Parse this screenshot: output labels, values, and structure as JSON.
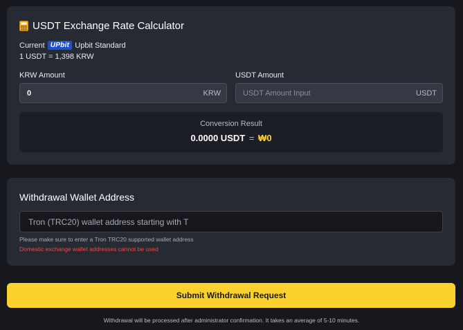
{
  "calculator": {
    "title": "USDT Exchange Rate Calculator",
    "icon": "calculator-icon",
    "rate_prefix": "Current",
    "exchange_logo": "UPbit",
    "rate_suffix": "Upbit Standard",
    "rate_value": "1 USDT = 1,398 KRW",
    "krw_label": "KRW Amount",
    "krw_value": "0",
    "krw_unit": "KRW",
    "usdt_label": "USDT Amount",
    "usdt_placeholder": "USDT Amount Input",
    "usdt_unit": "USDT",
    "result_label": "Conversion Result",
    "result_usdt": "0.0000 USDT",
    "result_eq": "=",
    "result_krw": "₩0"
  },
  "wallet": {
    "title": "Withdrawal Wallet Address",
    "placeholder": "Tron (TRC20) wallet address starting with T",
    "hint": "Please make sure to enter a Tron TRC20 supported wallet address",
    "warning": "Domestic exchange wallet addresses cannot be used"
  },
  "submit": {
    "label": "Submit Withdrawal Request"
  },
  "footer": {
    "note": "Withdrawal will be processed after administrator confirmation. It takes an average of 5-10 minutes."
  },
  "colors": {
    "accent": "#fbd12e",
    "warning": "#ef4a4a",
    "card": "#262a33",
    "background": "#16181d"
  }
}
